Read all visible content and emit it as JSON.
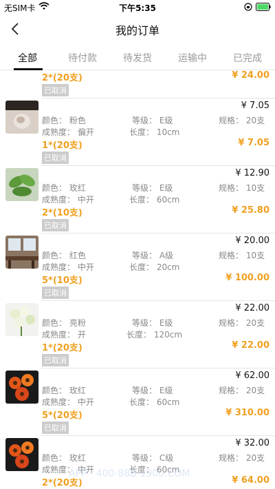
{
  "status_bar": {
    "carrier": "无SIM卡",
    "time": "下午5:35"
  },
  "nav": {
    "title": "我的订单"
  },
  "tabs": [
    "全部",
    "待付款",
    "待发货",
    "运输中",
    "已完成"
  ],
  "partial_order": {
    "qty": "2*(20支)",
    "total": "¥ 24.00",
    "status": "已取消"
  },
  "orders": [
    {
      "price": "¥ 7.05",
      "color": "颜色：  粉色",
      "grade": "等级：  E级",
      "spec": "规格：  20支",
      "maturity": "成熟度：  偏开",
      "length": "长度：  10cm",
      "qty": "1*(20支)",
      "total": "¥ 7.05",
      "status": "已取消",
      "image": "pink-flower-photo"
    },
    {
      "price": "¥ 12.90",
      "color": "颜色：  玫红",
      "grade": "等级：  E级",
      "spec": "规格：  10支",
      "maturity": "成熟度：  中开",
      "length": "长度：  60cm",
      "qty": "2*(10支)",
      "total": "¥ 25.80",
      "status": "已取消",
      "image": "green-leaf-photo"
    },
    {
      "price": "¥ 20.00",
      "color": "颜色：  红色",
      "grade": "等级：  A级",
      "spec": "规格：  10支",
      "maturity": "成熟度：  中开",
      "length": "长度：  20cm",
      "qty": "5*(10支)",
      "total": "¥ 100.00",
      "status": "已取消",
      "image": "room-interior-photo"
    },
    {
      "price": "¥ 22.00",
      "color": "颜色：  亮粉",
      "grade": "等级：  E级",
      "spec": "规格：  20支",
      "maturity": "成熟度：  开",
      "length": "长度：  120cm",
      "qty": "1*(20支)",
      "total": "¥ 22.00",
      "status": "已取消",
      "image": "white-bouquet-photo"
    },
    {
      "price": "¥ 62.00",
      "color": "颜色：  玫红",
      "grade": "等级：  E级",
      "spec": "规格：  20支",
      "maturity": "成熟度：  中开",
      "length": "长度：  60cm",
      "qty": "5*(20支)",
      "total": "¥ 310.00",
      "status": "已取消",
      "image": "orange-gerbera-photo"
    },
    {
      "price": "¥ 32.00",
      "color": "颜色：  玫红",
      "grade": "等级：  C级",
      "spec": "规格：  20支",
      "maturity": "成熟度：  中开",
      "length": "长度：  60cm",
      "qty": "2*(20支)",
      "total": "¥ 64.00",
      "status": "",
      "image": "orange-gerbera-photo"
    }
  ],
  "watermark": "APP · 400-888-1900.COM",
  "colors": {
    "accent": "#f0a020",
    "muted": "#888888",
    "badge": "#cccccc",
    "divider": "#e5e5e5"
  }
}
